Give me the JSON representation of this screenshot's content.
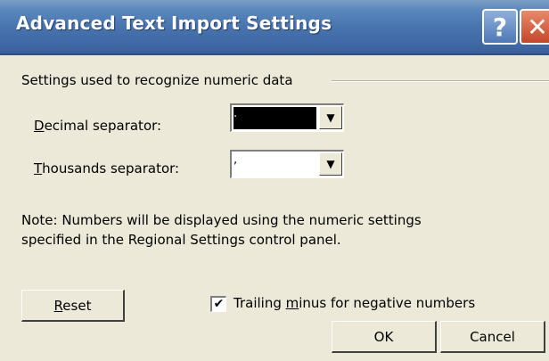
{
  "window": {
    "title": "Advanced Text Import Settings",
    "help_glyph": "?",
    "close_glyph": "✕"
  },
  "group": {
    "label": "Settings used to recognize numeric data"
  },
  "decimal": {
    "label_first": "D",
    "label_rest": "ecimal separator:",
    "value": ".",
    "arrow": "▼"
  },
  "thousands": {
    "label_first": "T",
    "label_rest": "housands separator:",
    "value": ",",
    "arrow": "▼"
  },
  "note": {
    "line1": "Note: Numbers will be displayed using the numeric settings",
    "line2": "specified in the Regional Settings control panel."
  },
  "reset_button": {
    "label_first": "R",
    "label_rest": "eset"
  },
  "trailing_minus": {
    "checked_glyph": "✔",
    "label_pre": "Trailing ",
    "label_u": "m",
    "label_post": "inus for negative numbers"
  },
  "ok_button": {
    "label": "OK"
  },
  "cancel_button": {
    "label": "Cancel"
  }
}
